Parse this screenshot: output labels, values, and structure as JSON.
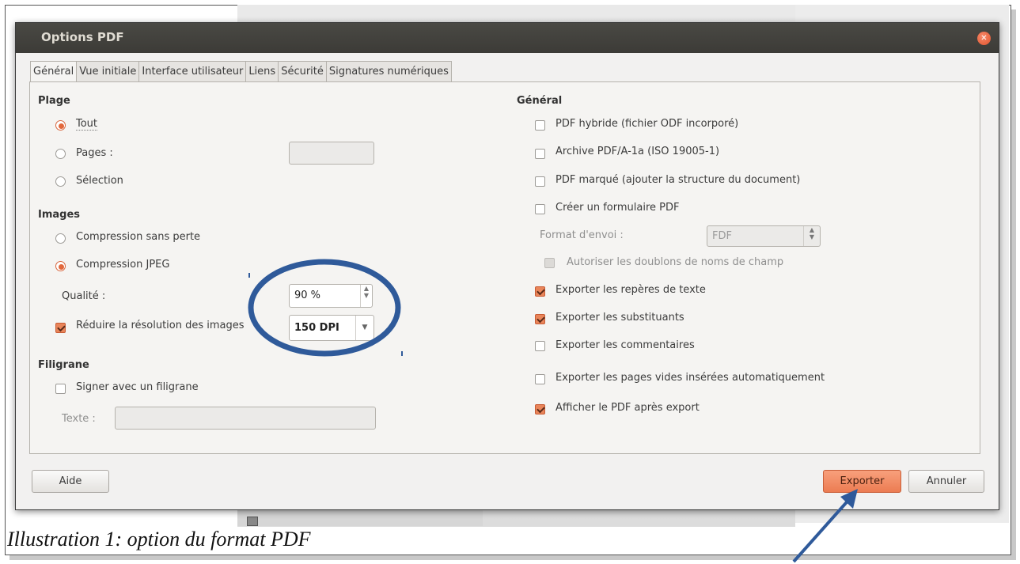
{
  "dialog": {
    "title": "Options PDF",
    "tabs": [
      "Général",
      "Vue initiale",
      "Interface utilisateur",
      "Liens",
      "Sécurité",
      "Signatures numériques"
    ],
    "active_tab": "Général"
  },
  "left": {
    "range_header": "Plage",
    "range_all": "Tout",
    "range_pages": "Pages :",
    "range_selection": "Sélection",
    "images_header": "Images",
    "lossless": "Compression sans perte",
    "jpeg": "Compression JPEG",
    "quality_label": "Qualité :",
    "quality_value": "90 %",
    "reduce_label": "Réduire la résolution des images",
    "reduce_value": "150 DPI",
    "watermark_header": "Filigrane",
    "watermark_sign": "Signer avec un filigrane",
    "text_label": "Texte :"
  },
  "right": {
    "general_header": "Général",
    "hybrid": "PDF hybride (fichier ODF incorporé)",
    "archive": "Archive PDF/A-1a (ISO 19005-1)",
    "tagged": "PDF marqué (ajouter la structure du document)",
    "form": "Créer un formulaire PDF",
    "submit_label": "Format d'envoi :",
    "submit_value": "FDF",
    "duplicates": "Autoriser les doublons de noms de champ",
    "bookmarks": "Exporter les repères de texte",
    "placeholders": "Exporter les substituants",
    "comments": "Exporter les commentaires",
    "blank_pages": "Exporter les pages vides insérées automatiquement",
    "view_after": "Afficher le PDF après export"
  },
  "buttons": {
    "help": "Aide",
    "export": "Exporter",
    "cancel": "Annuler"
  },
  "caption": "Illustration 1: option du format PDF",
  "colors": {
    "accent": "#e9855a",
    "annotation": "#2f5a9a",
    "titlebar": "#3c3b37"
  }
}
